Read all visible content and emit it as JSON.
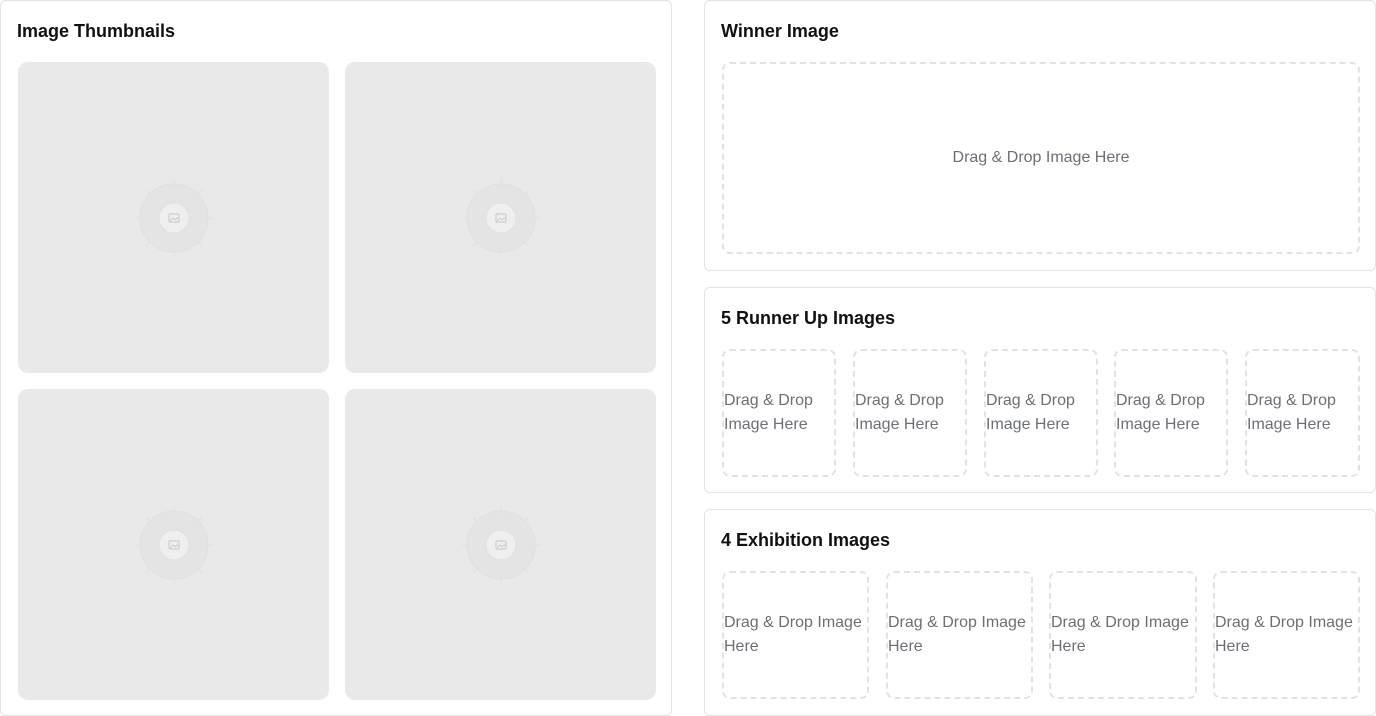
{
  "thumbnails": {
    "title": "Image Thumbnails",
    "items": [
      {
        "icon": "image-placeholder-icon"
      },
      {
        "icon": "image-placeholder-icon"
      },
      {
        "icon": "image-placeholder-icon"
      },
      {
        "icon": "image-placeholder-icon"
      }
    ]
  },
  "winner": {
    "title": "Winner Image",
    "drop_label": "Drag & Drop Image Here"
  },
  "runner_up": {
    "title": "5 Runner Up Images",
    "slots": [
      "Drag & Drop Image Here",
      "Drag & Drop Image Here",
      "Drag & Drop Image Here",
      "Drag & Drop Image Here",
      "Drag & Drop Image Here"
    ]
  },
  "exhibition": {
    "title": "4 Exhibition Images",
    "slots": [
      "Drag & Drop Image Here",
      "Drag & Drop Image Here",
      "Drag & Drop Image Here",
      "Drag & Drop Image Here"
    ]
  },
  "colors": {
    "thumbnail_bg": "#e9e9e9",
    "drop_border": "#e2e2e2",
    "drop_text": "#6b6f76"
  }
}
